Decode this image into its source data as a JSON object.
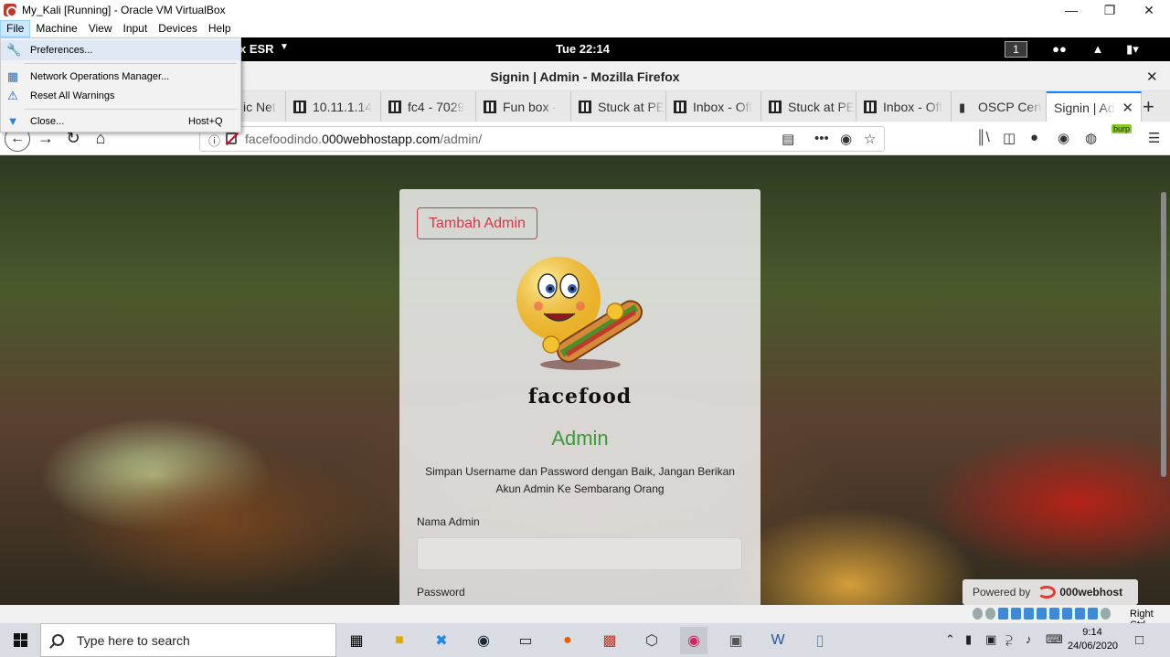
{
  "virtualbox": {
    "title": "My_Kali [Running] - Oracle VM VirtualBox",
    "menus": [
      "File",
      "Machine",
      "View",
      "Input",
      "Devices",
      "Help"
    ],
    "file_menu": [
      {
        "label": "Preferences...",
        "shortcut": "",
        "icon": "wrench-icon"
      },
      {
        "label": "Network Operations Manager...",
        "shortcut": "",
        "icon": "network-icon"
      },
      {
        "label": "Reset All Warnings",
        "shortcut": "",
        "icon": "warning-icon"
      },
      {
        "label": "Close...",
        "shortcut": "Host+Q",
        "icon": "close-icon"
      }
    ],
    "status_text": "Right Ctrl"
  },
  "kali_panel": {
    "app_label": "x ESR",
    "clock": "Tue 22:14",
    "workspace": "1"
  },
  "firefox": {
    "window_title": "Signin | Admin - Mozilla Firefox",
    "tabs": [
      {
        "label": "ic Net"
      },
      {
        "label": "10.11.1.14"
      },
      {
        "label": "fc4 - 7029"
      },
      {
        "label": "Fun box - "
      },
      {
        "label": "Stuck at PE"
      },
      {
        "label": "Inbox - Off"
      },
      {
        "label": "Stuck at PE"
      },
      {
        "label": "Inbox - Off"
      },
      {
        "label": "OSCP Cert"
      },
      {
        "label": "Signin | Ad"
      }
    ],
    "url_prefix": "facefoodindo.",
    "url_domain": "000webhostapp.com",
    "url_path": "/admin/",
    "burp_label": "burp"
  },
  "page": {
    "tambah_button": "Tambah Admin",
    "brand": "facefood",
    "heading": "Admin",
    "description": "Simpan Username dan Password dengan Baik, Jangan Berikan Akun Admin Ke Sembarang Orang",
    "username_label": "Nama Admin",
    "password_label": "Password",
    "powered_by": "Powered by",
    "powered_brand": "000webhost"
  },
  "taskbar": {
    "search_placeholder": "Type here to search",
    "time": "9:14",
    "date": "24/06/2020"
  },
  "colors": {
    "accent_tab": "#0a84ff",
    "danger": "#dc3545",
    "admin_green": "#3a9a3a"
  }
}
